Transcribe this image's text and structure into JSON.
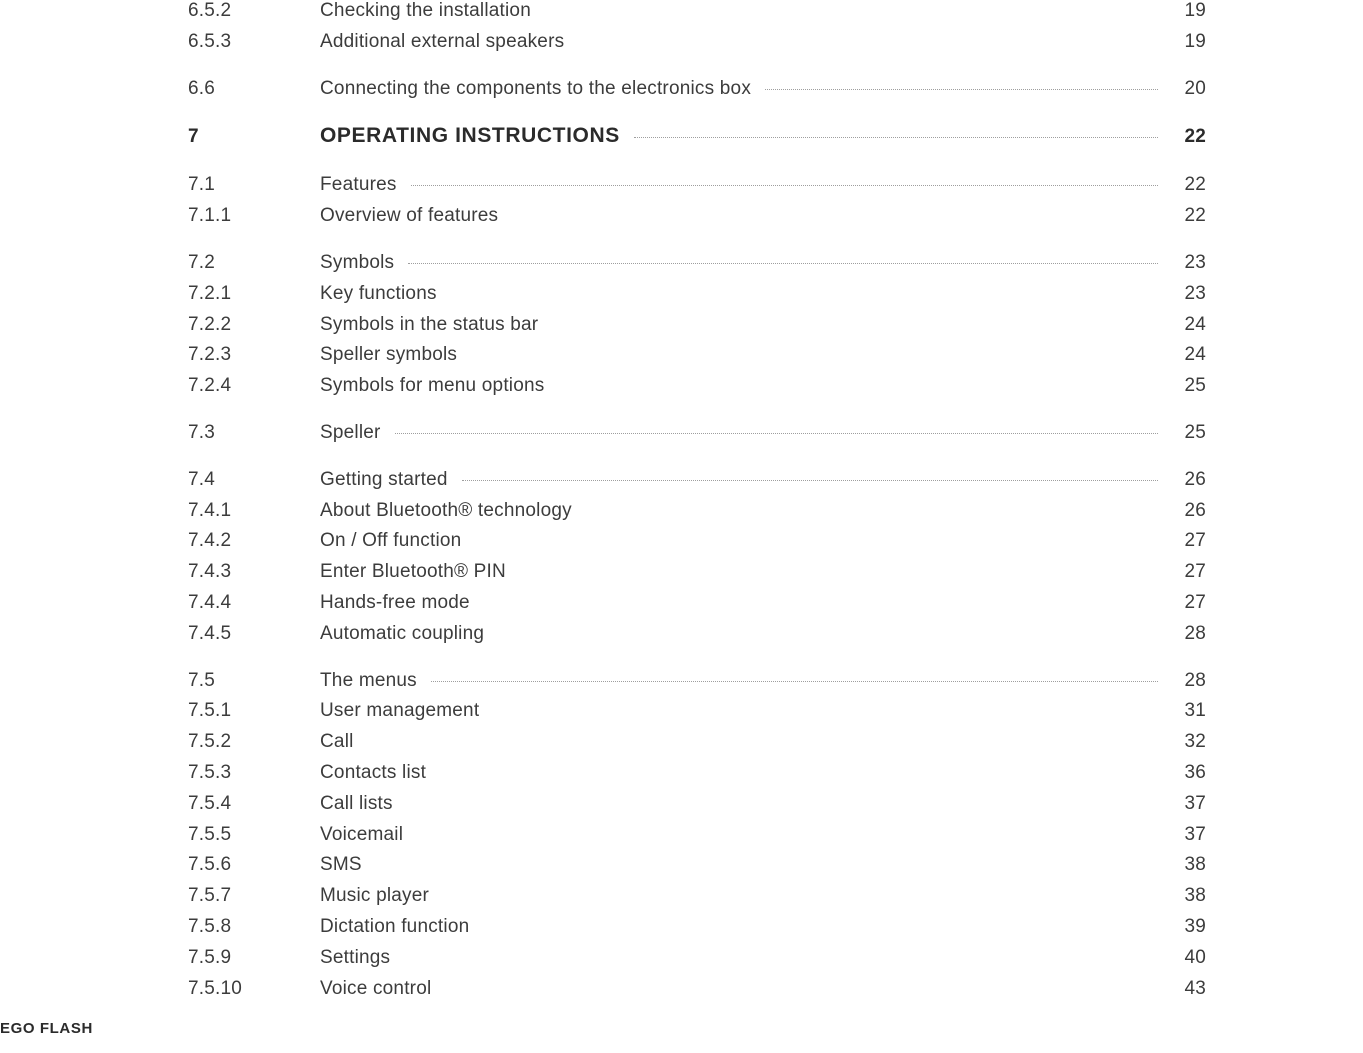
{
  "footer": {
    "label": "EGO FLASH"
  },
  "toc": [
    {
      "type": "row",
      "num": "6.5.2",
      "title": "Checking the installation",
      "page": "19",
      "leader": false
    },
    {
      "type": "row",
      "num": "6.5.3",
      "title": "Additional external speakers",
      "page": "19",
      "leader": false
    },
    {
      "type": "gap"
    },
    {
      "type": "row",
      "num": "6.6",
      "title": "Connecting the components to the electronics box",
      "page": "20",
      "leader": true
    },
    {
      "type": "gap"
    },
    {
      "type": "chapter",
      "num": "7",
      "title": "OPERATING INSTRUCTIONS",
      "page": "22",
      "leader": true
    },
    {
      "type": "gap"
    },
    {
      "type": "row",
      "num": "7.1",
      "title": "Features",
      "page": "22",
      "leader": true
    },
    {
      "type": "row",
      "num": "7.1.1",
      "title": "Overview of features",
      "page": "22",
      "leader": false
    },
    {
      "type": "gap"
    },
    {
      "type": "row",
      "num": "7.2",
      "title": "Symbols",
      "page": "23",
      "leader": true
    },
    {
      "type": "row",
      "num": "7.2.1",
      "title": "Key functions",
      "page": "23",
      "leader": false
    },
    {
      "type": "row",
      "num": "7.2.2",
      "title": "Symbols in the status bar",
      "page": "24",
      "leader": false
    },
    {
      "type": "row",
      "num": "7.2.3",
      "title": "Speller symbols",
      "page": "24",
      "leader": false
    },
    {
      "type": "row",
      "num": "7.2.4",
      "title": "Symbols for menu options",
      "page": "25",
      "leader": false
    },
    {
      "type": "gap"
    },
    {
      "type": "row",
      "num": "7.3",
      "title": "Speller",
      "page": "25",
      "leader": true
    },
    {
      "type": "gap"
    },
    {
      "type": "row",
      "num": "7.4",
      "title": "Getting started",
      "page": "26",
      "leader": true
    },
    {
      "type": "row",
      "num": "7.4.1",
      "title": "About Bluetooth® technology",
      "page": "26",
      "leader": false
    },
    {
      "type": "row",
      "num": "7.4.2",
      "title": "On / Off function",
      "page": "27",
      "leader": false
    },
    {
      "type": "row",
      "num": "7.4.3",
      "title": "Enter Bluetooth® PIN",
      "page": "27",
      "leader": false
    },
    {
      "type": "row",
      "num": "7.4.4",
      "title": "Hands-free mode",
      "page": "27",
      "leader": false
    },
    {
      "type": "row",
      "num": "7.4.5",
      "title": "Automatic coupling",
      "page": "28",
      "leader": false
    },
    {
      "type": "gap"
    },
    {
      "type": "row",
      "num": "7.5",
      "title": "The menus",
      "page": "28",
      "leader": true
    },
    {
      "type": "row",
      "num": "7.5.1",
      "title": "User management",
      "page": "31",
      "leader": false
    },
    {
      "type": "row",
      "num": "7.5.2",
      "title": "Call",
      "page": "32",
      "leader": false
    },
    {
      "type": "row",
      "num": "7.5.3",
      "title": "Contacts list",
      "page": "36",
      "leader": false
    },
    {
      "type": "row",
      "num": "7.5.4",
      "title": "Call lists",
      "page": "37",
      "leader": false
    },
    {
      "type": "row",
      "num": "7.5.5",
      "title": "Voicemail",
      "page": "37",
      "leader": false
    },
    {
      "type": "row",
      "num": "7.5.6",
      "title": "SMS",
      "page": "38",
      "leader": false
    },
    {
      "type": "row",
      "num": "7.5.7",
      "title": "Music player",
      "page": "38",
      "leader": false
    },
    {
      "type": "row",
      "num": "7.5.8",
      "title": "Dictation function",
      "page": "39",
      "leader": false
    },
    {
      "type": "row",
      "num": "7.5.9",
      "title": "Settings",
      "page": "40",
      "leader": false
    },
    {
      "type": "row",
      "num": "7.5.10",
      "title": "Voice control",
      "page": "43",
      "leader": false
    }
  ]
}
